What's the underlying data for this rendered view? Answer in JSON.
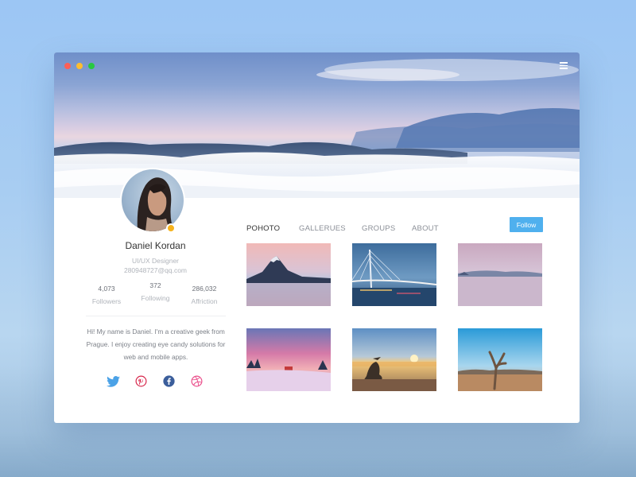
{
  "window": {
    "traffic_lights": {
      "close": "#ff5f57",
      "minimize": "#ffbd2e",
      "maximize": "#28c940"
    },
    "menu_icon": "hamburger-icon"
  },
  "profile": {
    "name": "Daniel Kordan",
    "role": "UI/UX Designer",
    "email": "280948727@qq.com",
    "status_color": "#f6b21c",
    "stats": [
      {
        "value": "4,073",
        "label": "Followers"
      },
      {
        "value": "372",
        "label": "Following"
      },
      {
        "value": "286,032",
        "label": "Affriction"
      }
    ],
    "bio": "Hi! My name is Daniel. I'm a creative geek from Prague. I enjoy creating eye candy solutions for web and mobile apps.",
    "socials": [
      {
        "name": "twitter-icon",
        "color": "#4ba2e7"
      },
      {
        "name": "pinterest-icon",
        "color": "#d7254a"
      },
      {
        "name": "facebook-icon",
        "color": "#3b5e9b"
      },
      {
        "name": "dribbble-icon",
        "color": "#ea4c89"
      }
    ]
  },
  "tabs": [
    {
      "label": "POHOTO",
      "active": true
    },
    {
      "label": "GALLERUES",
      "active": false
    },
    {
      "label": "GROUPS",
      "active": false
    },
    {
      "label": "ABOUT",
      "active": false
    }
  ],
  "follow_button": {
    "label": "Follow",
    "color": "#4fb0ee"
  },
  "gallery": [
    {
      "name": "mountain-lake-photo"
    },
    {
      "name": "bridge-night-photo"
    },
    {
      "name": "misty-lake-photo"
    },
    {
      "name": "winter-sunset-photo"
    },
    {
      "name": "beach-sunset-photo"
    },
    {
      "name": "driftwood-desert-photo"
    }
  ]
}
